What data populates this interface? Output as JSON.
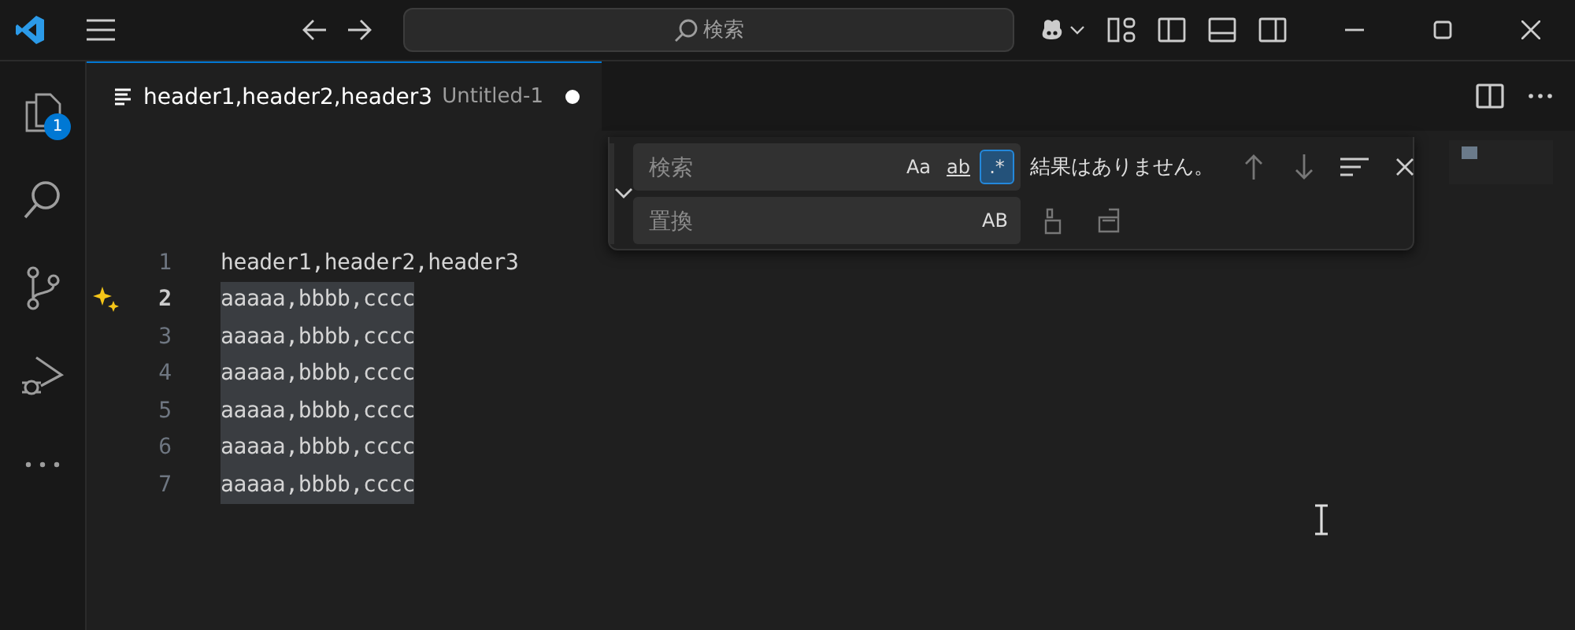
{
  "title_bar": {
    "command_center": {
      "placeholder": "検索"
    }
  },
  "activity_bar": {
    "items": [
      {
        "kind": "explorer",
        "badge": "1"
      },
      {
        "kind": "search"
      },
      {
        "kind": "source-control"
      },
      {
        "kind": "debug"
      },
      {
        "kind": "more"
      }
    ]
  },
  "tab": {
    "label": "header1,header2,header3",
    "description": "Untitled-1",
    "dirty": true,
    "selected": true
  },
  "find_widget": {
    "expanded": true,
    "find_placeholder": "検索",
    "toggles": [
      {
        "label": "Aa",
        "selected": false,
        "underline": false
      },
      {
        "label": "ab",
        "selected": false,
        "underline": true
      },
      {
        "label": ".*",
        "selected": true,
        "underline": false
      }
    ],
    "status": "結果はありません。",
    "replace_placeholder": "置換",
    "replace_toggles": [
      {
        "label": "AB",
        "selected": false
      }
    ]
  },
  "editor": {
    "lines": [
      {
        "number": "1",
        "text": "header1,header2,header3",
        "current": false,
        "selected": false
      },
      {
        "number": "2",
        "text": "aaaaa,bbbb,cccc",
        "current": true,
        "selected": true
      },
      {
        "number": "3",
        "text": "aaaaa,bbbb,cccc",
        "current": false,
        "selected": true
      },
      {
        "number": "4",
        "text": "aaaaa,bbbb,cccc",
        "current": false,
        "selected": true
      },
      {
        "number": "5",
        "text": "aaaaa,bbbb,cccc",
        "current": false,
        "selected": true
      },
      {
        "number": "6",
        "text": "aaaaa,bbbb,cccc",
        "current": false,
        "selected": true
      },
      {
        "number": "7",
        "text": "aaaaa,bbbb,cccc",
        "current": false,
        "selected": true
      }
    ]
  }
}
